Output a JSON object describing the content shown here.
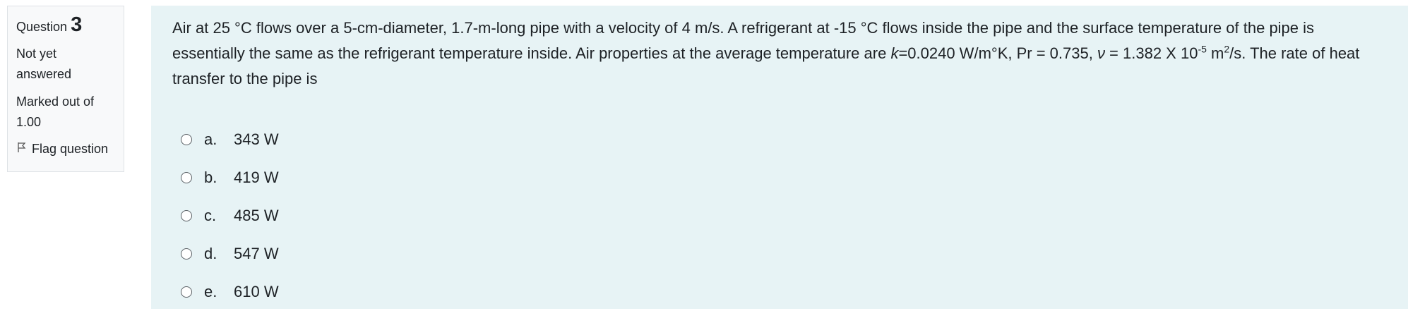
{
  "question_info": {
    "label": "Question",
    "number": "3",
    "state_line1": "Not yet",
    "state_line2": "answered",
    "grade_line1": "Marked out of",
    "grade_line2": "1.00",
    "flag_label": "Flag question",
    "flag_icon": "flag-icon"
  },
  "question": {
    "text_part1": "Air at 25 °C flows over a 5-cm-diameter, 1.7-m-long pipe with a velocity of 4 m/s. A refrigerant at -15 °C flows inside the pipe and the surface temperature of the pipe is essentially the same as the refrigerant temperature inside. Air properties at the average temperature are ",
    "k_symbol": "k",
    "text_part2": "=0.0240 W/m°K, Pr = 0.735, ",
    "nu_symbol": "ν",
    "text_part3": " = 1.382 X 10",
    "exp1": "-5",
    "text_part4": " m",
    "exp2": "2",
    "text_part5": "/s. The rate of heat transfer to the pipe is"
  },
  "answers": [
    {
      "letter": "a.",
      "text": "343 W"
    },
    {
      "letter": "b.",
      "text": "419 W"
    },
    {
      "letter": "c.",
      "text": "485 W"
    },
    {
      "letter": "d.",
      "text": "547 W"
    },
    {
      "letter": "e.",
      "text": "610 W"
    }
  ]
}
